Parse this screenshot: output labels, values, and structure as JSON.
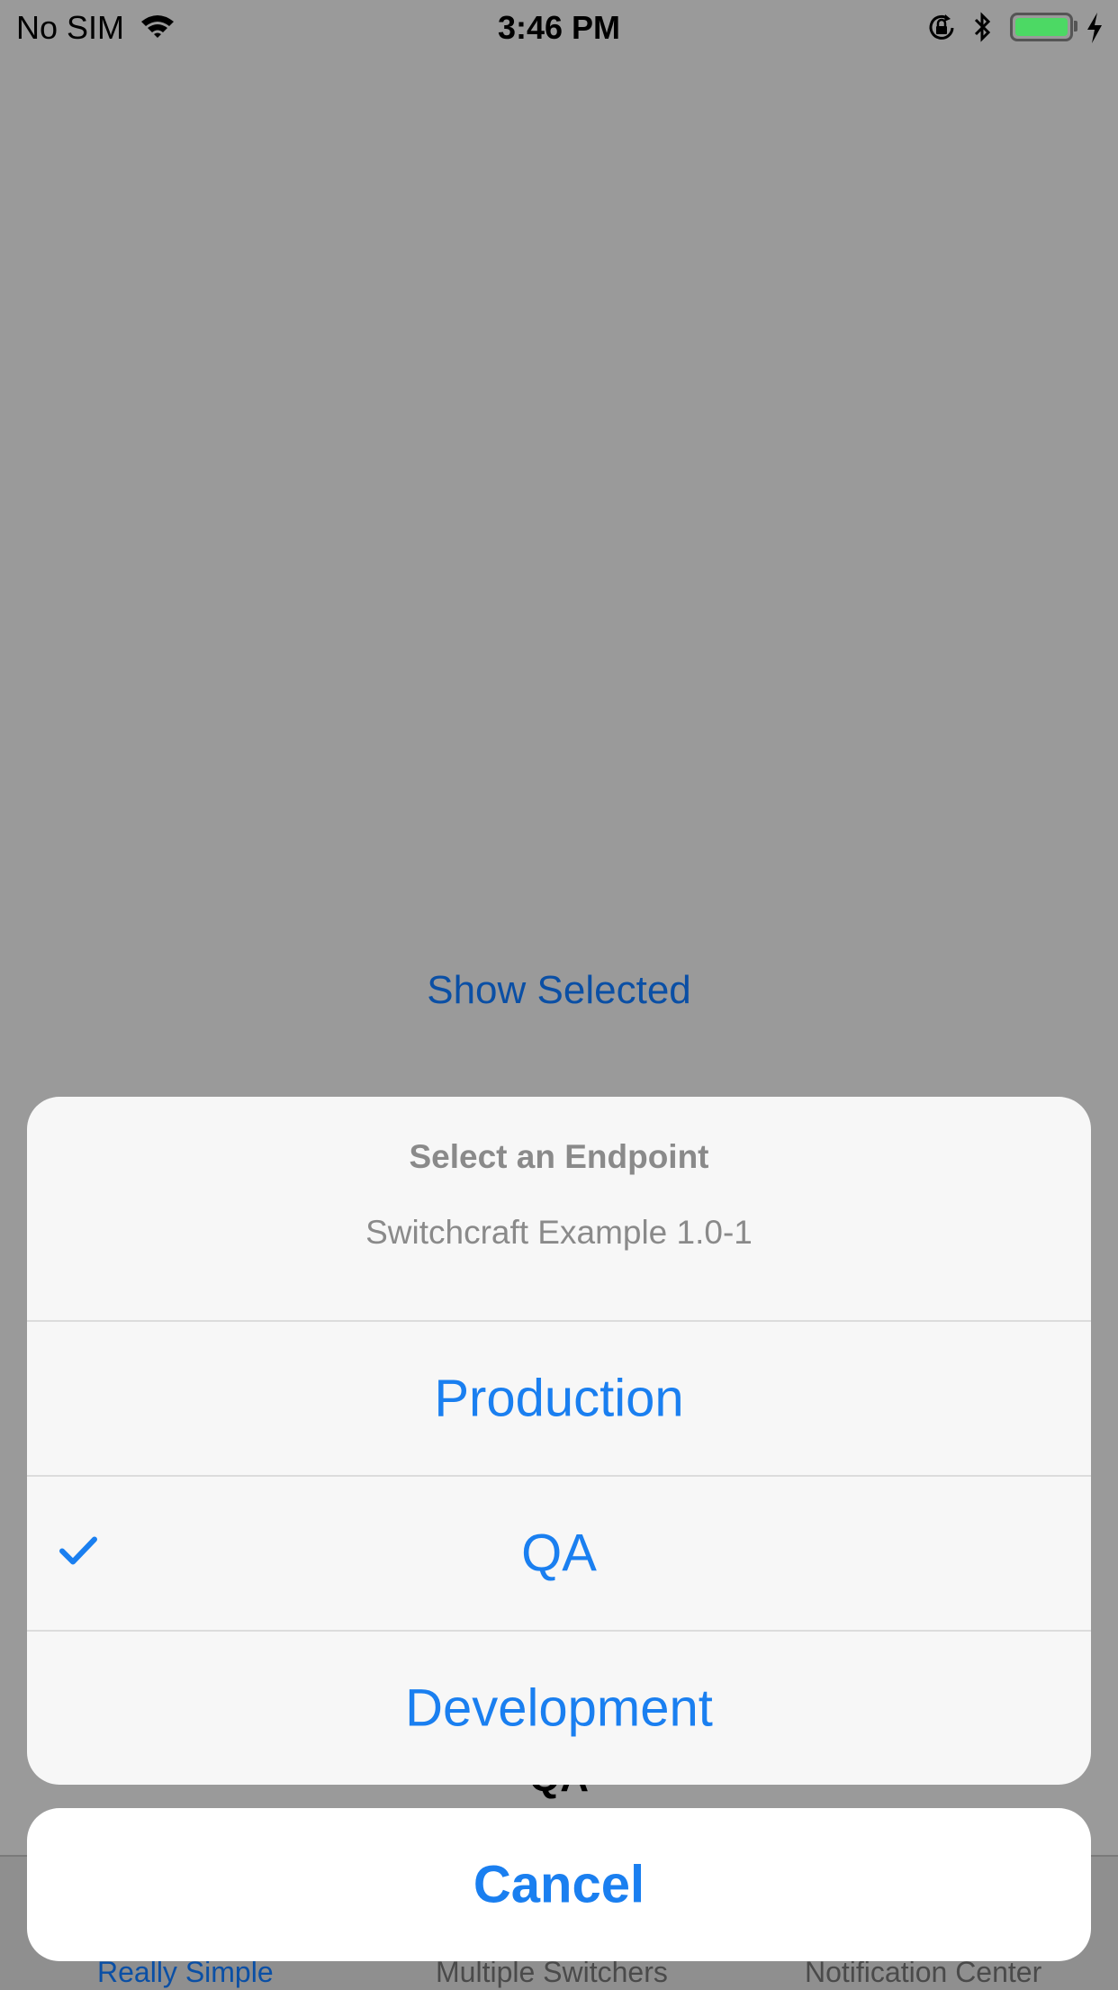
{
  "status_bar": {
    "carrier": "No SIM",
    "time": "3:46 PM",
    "battery_color": "#4cd964",
    "icons": [
      "wifi-icon",
      "rotation-lock-icon",
      "bluetooth-icon",
      "battery-icon",
      "charging-icon"
    ]
  },
  "background": {
    "show_selected_label": "Show Selected",
    "selected_value": "QA"
  },
  "tab_bar": {
    "tabs": [
      {
        "label": "Really Simple",
        "active": true
      },
      {
        "label": "Multiple Switchers",
        "active": false
      },
      {
        "label": "Notification Center",
        "active": false
      }
    ]
  },
  "action_sheet": {
    "title": "Select an Endpoint",
    "message": "Switchcraft Example 1.0-1",
    "options": [
      {
        "label": "Production",
        "selected": false
      },
      {
        "label": "QA",
        "selected": true
      },
      {
        "label": "Development",
        "selected": false
      }
    ],
    "cancel_label": "Cancel",
    "accent_color": "#1a7ff0"
  }
}
